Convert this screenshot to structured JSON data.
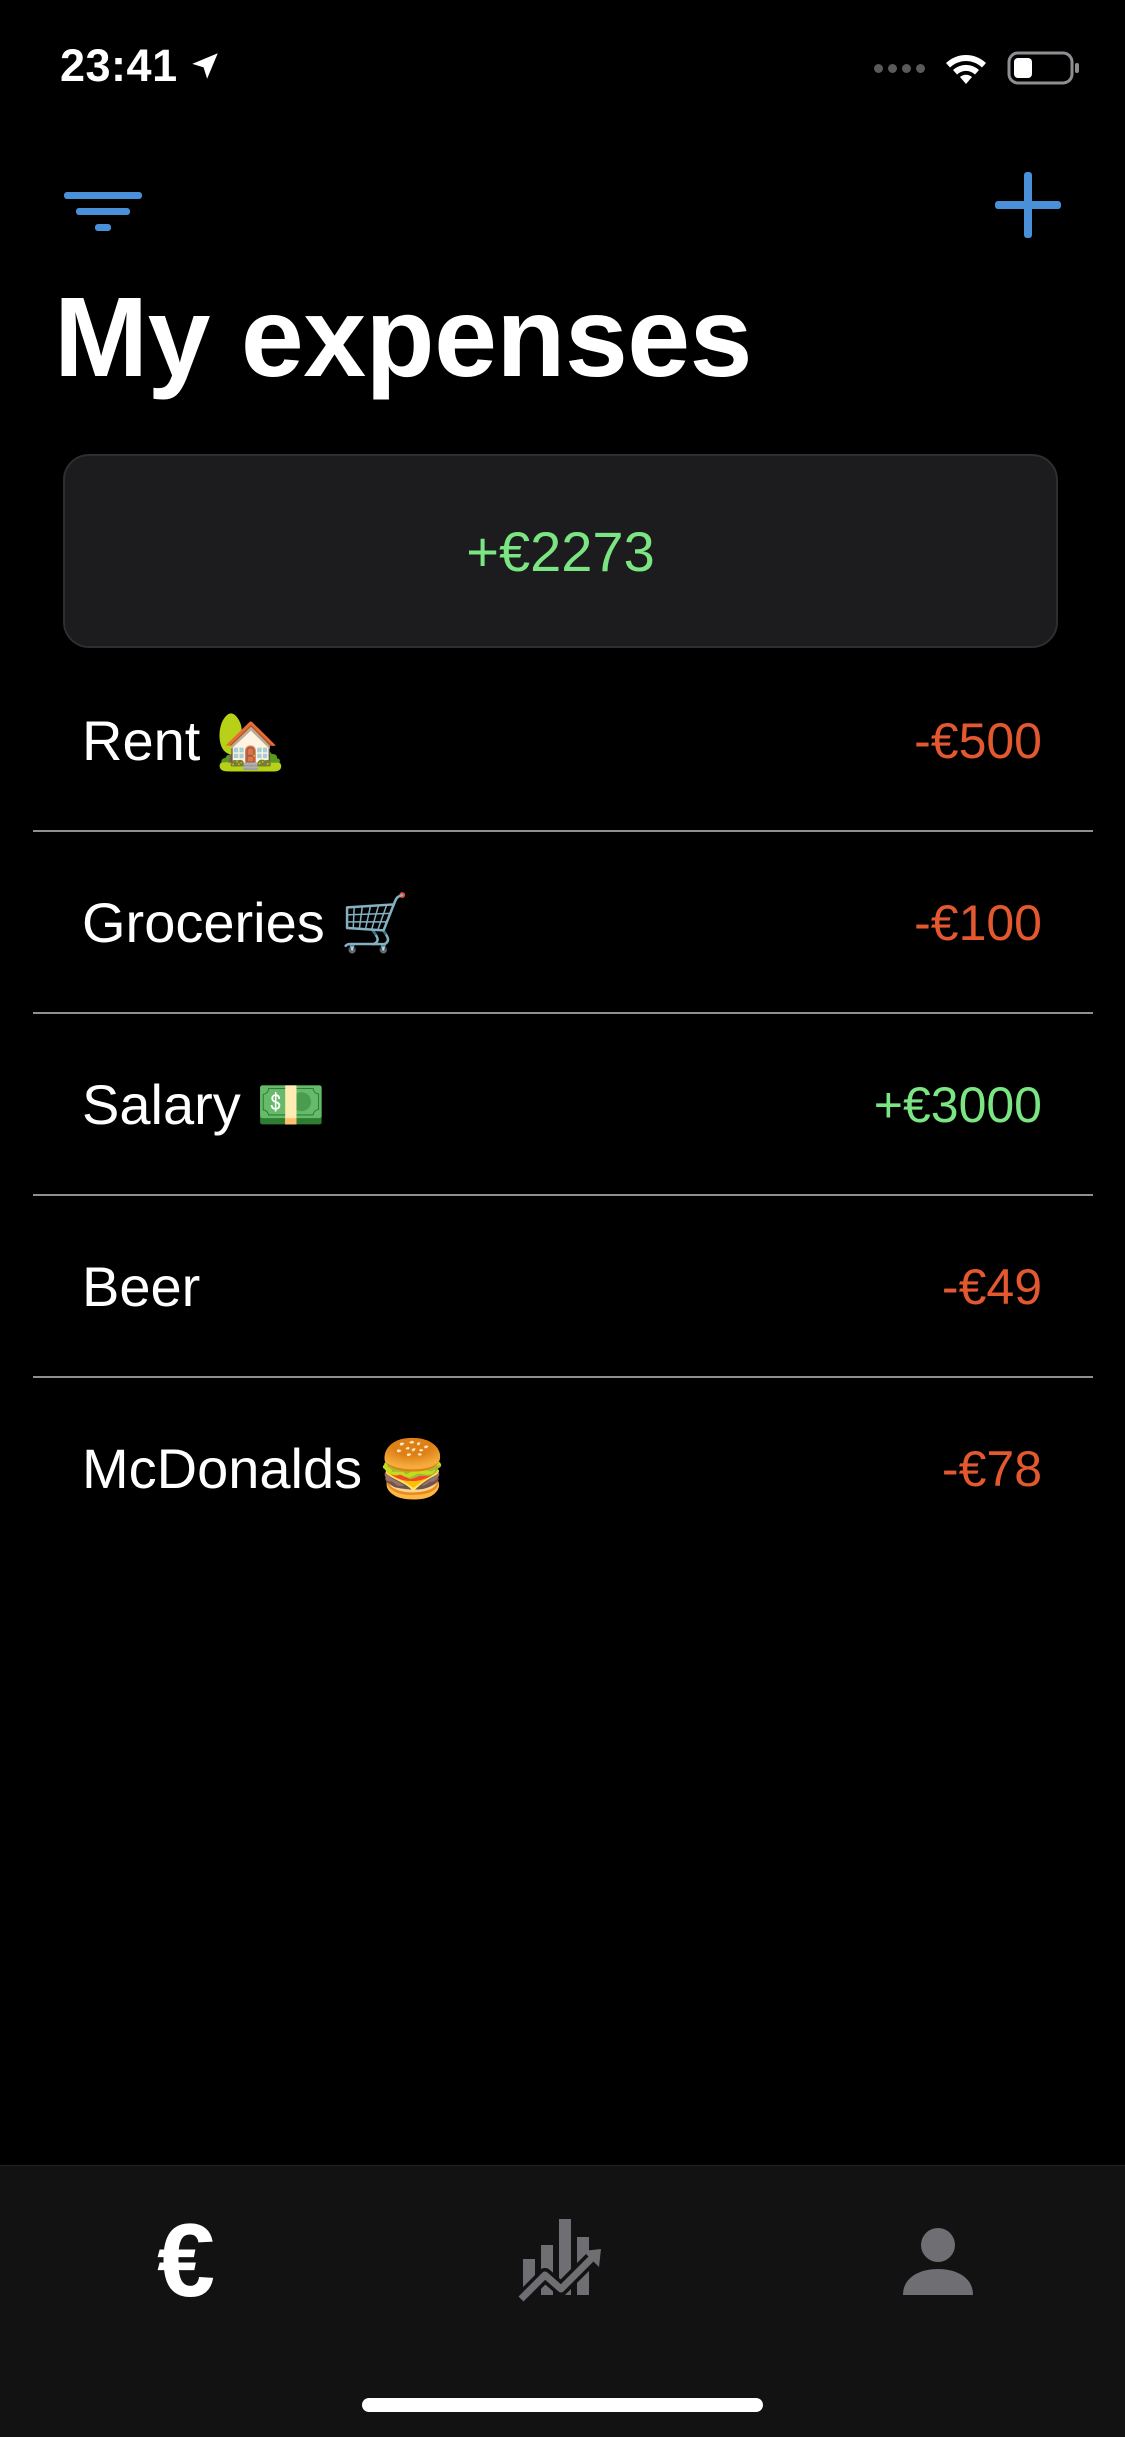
{
  "status_bar": {
    "time": "23:41"
  },
  "header": {
    "title": "My expenses"
  },
  "balance": {
    "value": "+€2273"
  },
  "expenses": [
    {
      "name": "Rent 🏡",
      "amount": "-€500",
      "type": "negative"
    },
    {
      "name": "Groceries 🛒",
      "amount": "-€100",
      "type": "negative"
    },
    {
      "name": "Salary 💵",
      "amount": "+€3000",
      "type": "positive"
    },
    {
      "name": "Beer",
      "amount": "-€49",
      "type": "negative"
    },
    {
      "name": "McDonalds 🍔",
      "amount": "-€78",
      "type": "negative"
    }
  ],
  "tab_bar": {
    "expenses_tab_glyph": "€",
    "tabs": [
      "expenses",
      "statistics",
      "profile"
    ]
  },
  "colors": {
    "accent": "#4a90d9",
    "positive": "#7ae582",
    "negative": "#e4582f",
    "card_bg": "#1c1c1e",
    "tab_inactive": "#6e6e73"
  }
}
